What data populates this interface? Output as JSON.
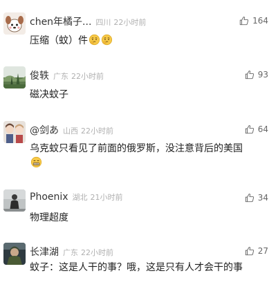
{
  "comments": [
    {
      "username": "chen年橘子...",
      "location": "四川",
      "time": "22小时前",
      "text": "压缩（蚊）件",
      "emoji": [
        "emoji-thinking-icon",
        "emoji-thinking-icon"
      ],
      "likes": "164",
      "avatar_icon": "cartoon-dog-avatar-icon"
    },
    {
      "username": "俊轶",
      "location": "广东",
      "time": "22小时前",
      "text": "磁决蚊子",
      "likes": "93",
      "avatar_icon": "landscape-avatar-icon"
    },
    {
      "username": "@剑あ",
      "location": "山西",
      "time": "22小时前",
      "text": "乌克蚊只看见了前面的俄罗斯，没注意背后的美国",
      "emoji": [
        "emoji-grin-icon"
      ],
      "likes": "64",
      "avatar_icon": "anime-character-avatar-icon"
    },
    {
      "username": "Phoenix",
      "location": "湖北",
      "time": "21小时前",
      "text": "物理超度",
      "likes": "34",
      "avatar_icon": "dark-figure-avatar-icon"
    },
    {
      "username": "长津湖",
      "location": "广东",
      "time": "22小时前",
      "text": "蚊子：这是人干的事？哦，这是只有人才会干的事",
      "likes": "27",
      "avatar_icon": "soldier-avatar-icon"
    }
  ],
  "colors": {
    "meta_gray": "#b0b0b0",
    "username": "#333333",
    "text": "#222222",
    "emoji_yellow": "#f7c948"
  }
}
